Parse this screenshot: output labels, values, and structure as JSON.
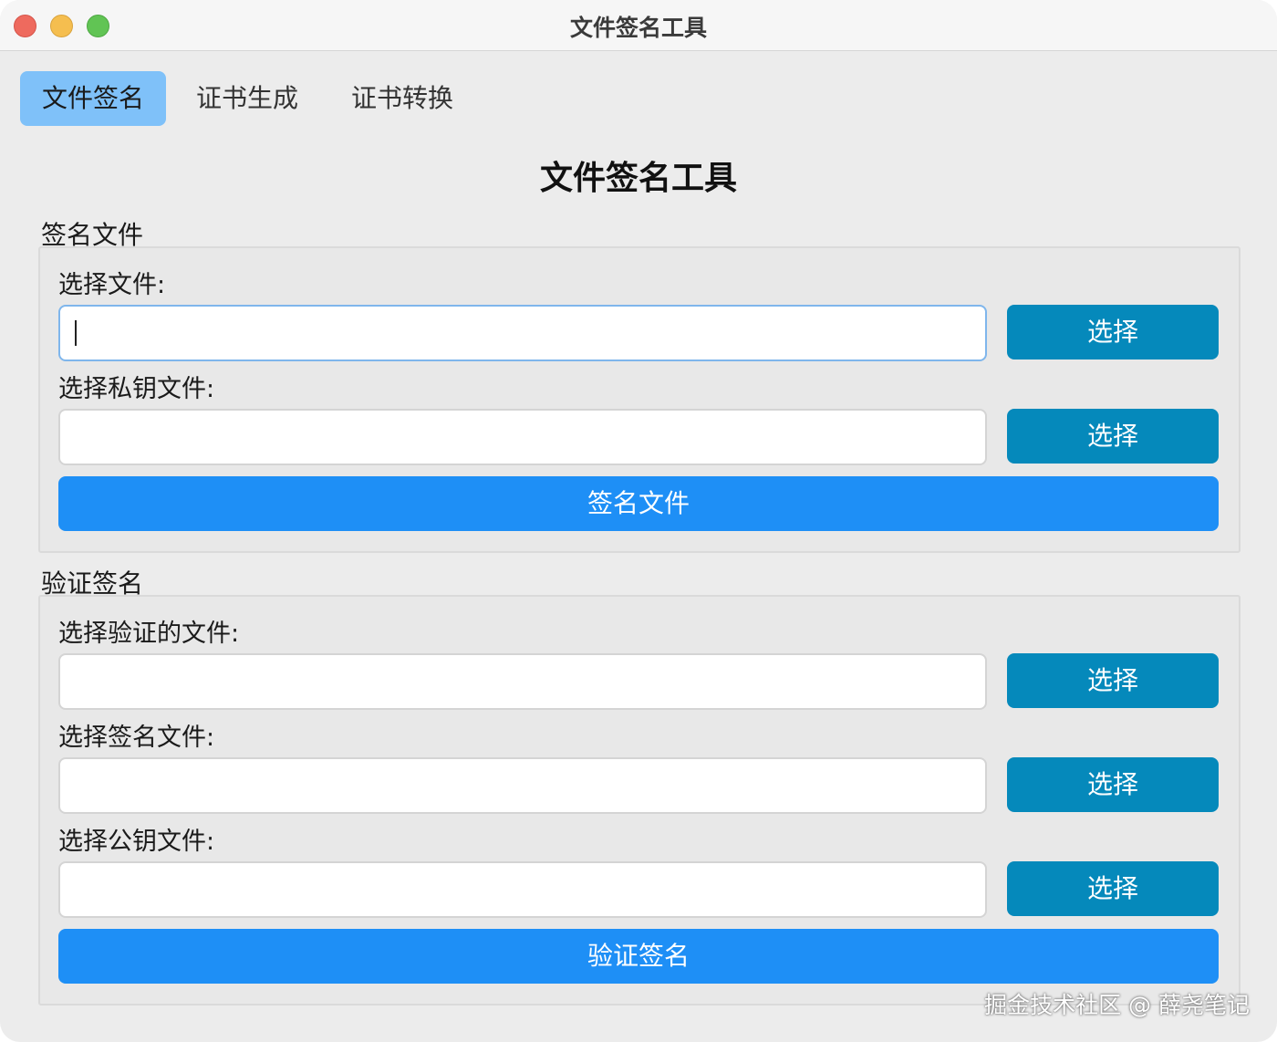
{
  "window": {
    "title": "文件签名工具"
  },
  "tabs": [
    {
      "label": "文件签名",
      "active": true
    },
    {
      "label": "证书生成",
      "active": false
    },
    {
      "label": "证书转换",
      "active": false
    }
  ],
  "main": {
    "heading": "文件签名工具"
  },
  "sign_group": {
    "title": "签名文件",
    "file_label": "选择文件:",
    "file_value": "",
    "private_key_label": "选择私钥文件:",
    "private_key_value": "",
    "select_label": "选择",
    "action_label": "签名文件"
  },
  "verify_group": {
    "title": "验证签名",
    "verify_file_label": "选择验证的文件:",
    "verify_file_value": "",
    "signature_file_label": "选择签名文件:",
    "signature_file_value": "",
    "public_key_label": "选择公钥文件:",
    "public_key_value": "",
    "select_label": "选择",
    "action_label": "验证签名"
  },
  "watermark": "掘金技术社区 @ 薛尧笔记",
  "colors": {
    "tab_active": "#7fc1f9",
    "select_button": "#0589bb",
    "action_button": "#1e8ff6",
    "focus_border": "#7fb6ec"
  }
}
